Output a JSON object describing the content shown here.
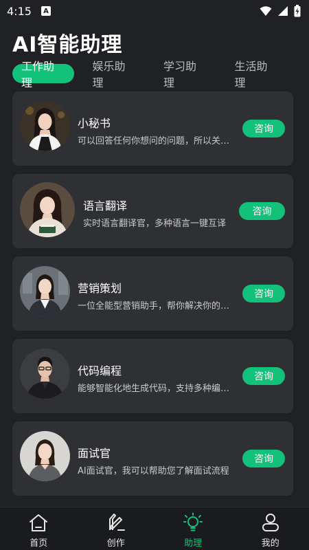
{
  "status_bar": {
    "time": "4:15",
    "app_icon_letter": "A"
  },
  "page": {
    "title": "AI智能助理"
  },
  "tabs": [
    {
      "label": "工作助理",
      "active": true
    },
    {
      "label": "娱乐助理",
      "active": false
    },
    {
      "label": "学习助理",
      "active": false
    },
    {
      "label": "生活助理",
      "active": false
    }
  ],
  "assistants": [
    {
      "name": "小秘书",
      "description": "可以回答任何你想问的问题，所以关于工作上的问题",
      "button": "咨询"
    },
    {
      "name": "语言翻译",
      "description": "实时语言翻译官，多种语言一键互译",
      "button": "咨询"
    },
    {
      "name": "营销策划",
      "description": "一位全能型营销助手，帮你解决你的营销问题",
      "button": "咨询"
    },
    {
      "name": "代码编程",
      "description": "能够智能化地生成代码，支持多种编程语言",
      "button": "咨询"
    },
    {
      "name": "面试官",
      "description": "AI面试官，我可以帮助您了解面试流程",
      "button": "咨询"
    }
  ],
  "bottom_nav": [
    {
      "label": "首页",
      "icon": "home-icon",
      "active": false
    },
    {
      "label": "创作",
      "icon": "create-pen-icon",
      "active": false
    },
    {
      "label": "助理",
      "icon": "lightbulb-icon",
      "active": true
    },
    {
      "label": "我的",
      "icon": "profile-icon",
      "active": false
    }
  ],
  "colors": {
    "accent": "#12c27a",
    "background": "#202124",
    "card": "#2f3033",
    "nav": "#1a1b1e"
  }
}
